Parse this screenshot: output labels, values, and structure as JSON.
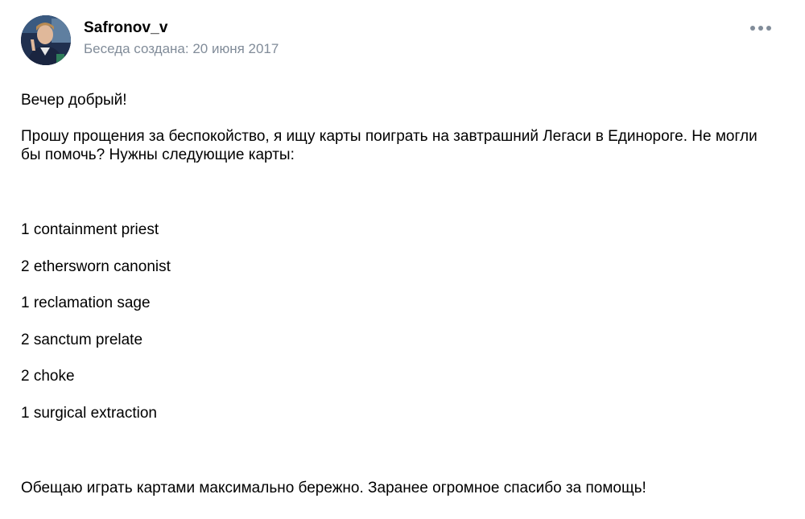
{
  "author": {
    "name": "Safronov_v",
    "created": "Беседа создана: 20 июня 2017"
  },
  "menu": {
    "icon": "more-horizontal-icon"
  },
  "message": {
    "greeting": "Вечер добрый!",
    "request": "Прошу прощения за беспокойство, я ищу карты поиграть на завтрашний Легаси в Единороге. Не могли бы помочь? Нужны следующие карты:",
    "cards": [
      "1 containment priest",
      "2 ethersworn canonist",
      "1 reclamation sage",
      "2 sanctum prelate",
      "2 choke",
      "1 surgical extraction"
    ],
    "closing": "Обещаю играть картами максимально бережно. Заранее огромное спасибо за помощь!"
  },
  "colors": {
    "meta_text": "#818c99",
    "body_text": "#000000",
    "background": "#ffffff"
  }
}
